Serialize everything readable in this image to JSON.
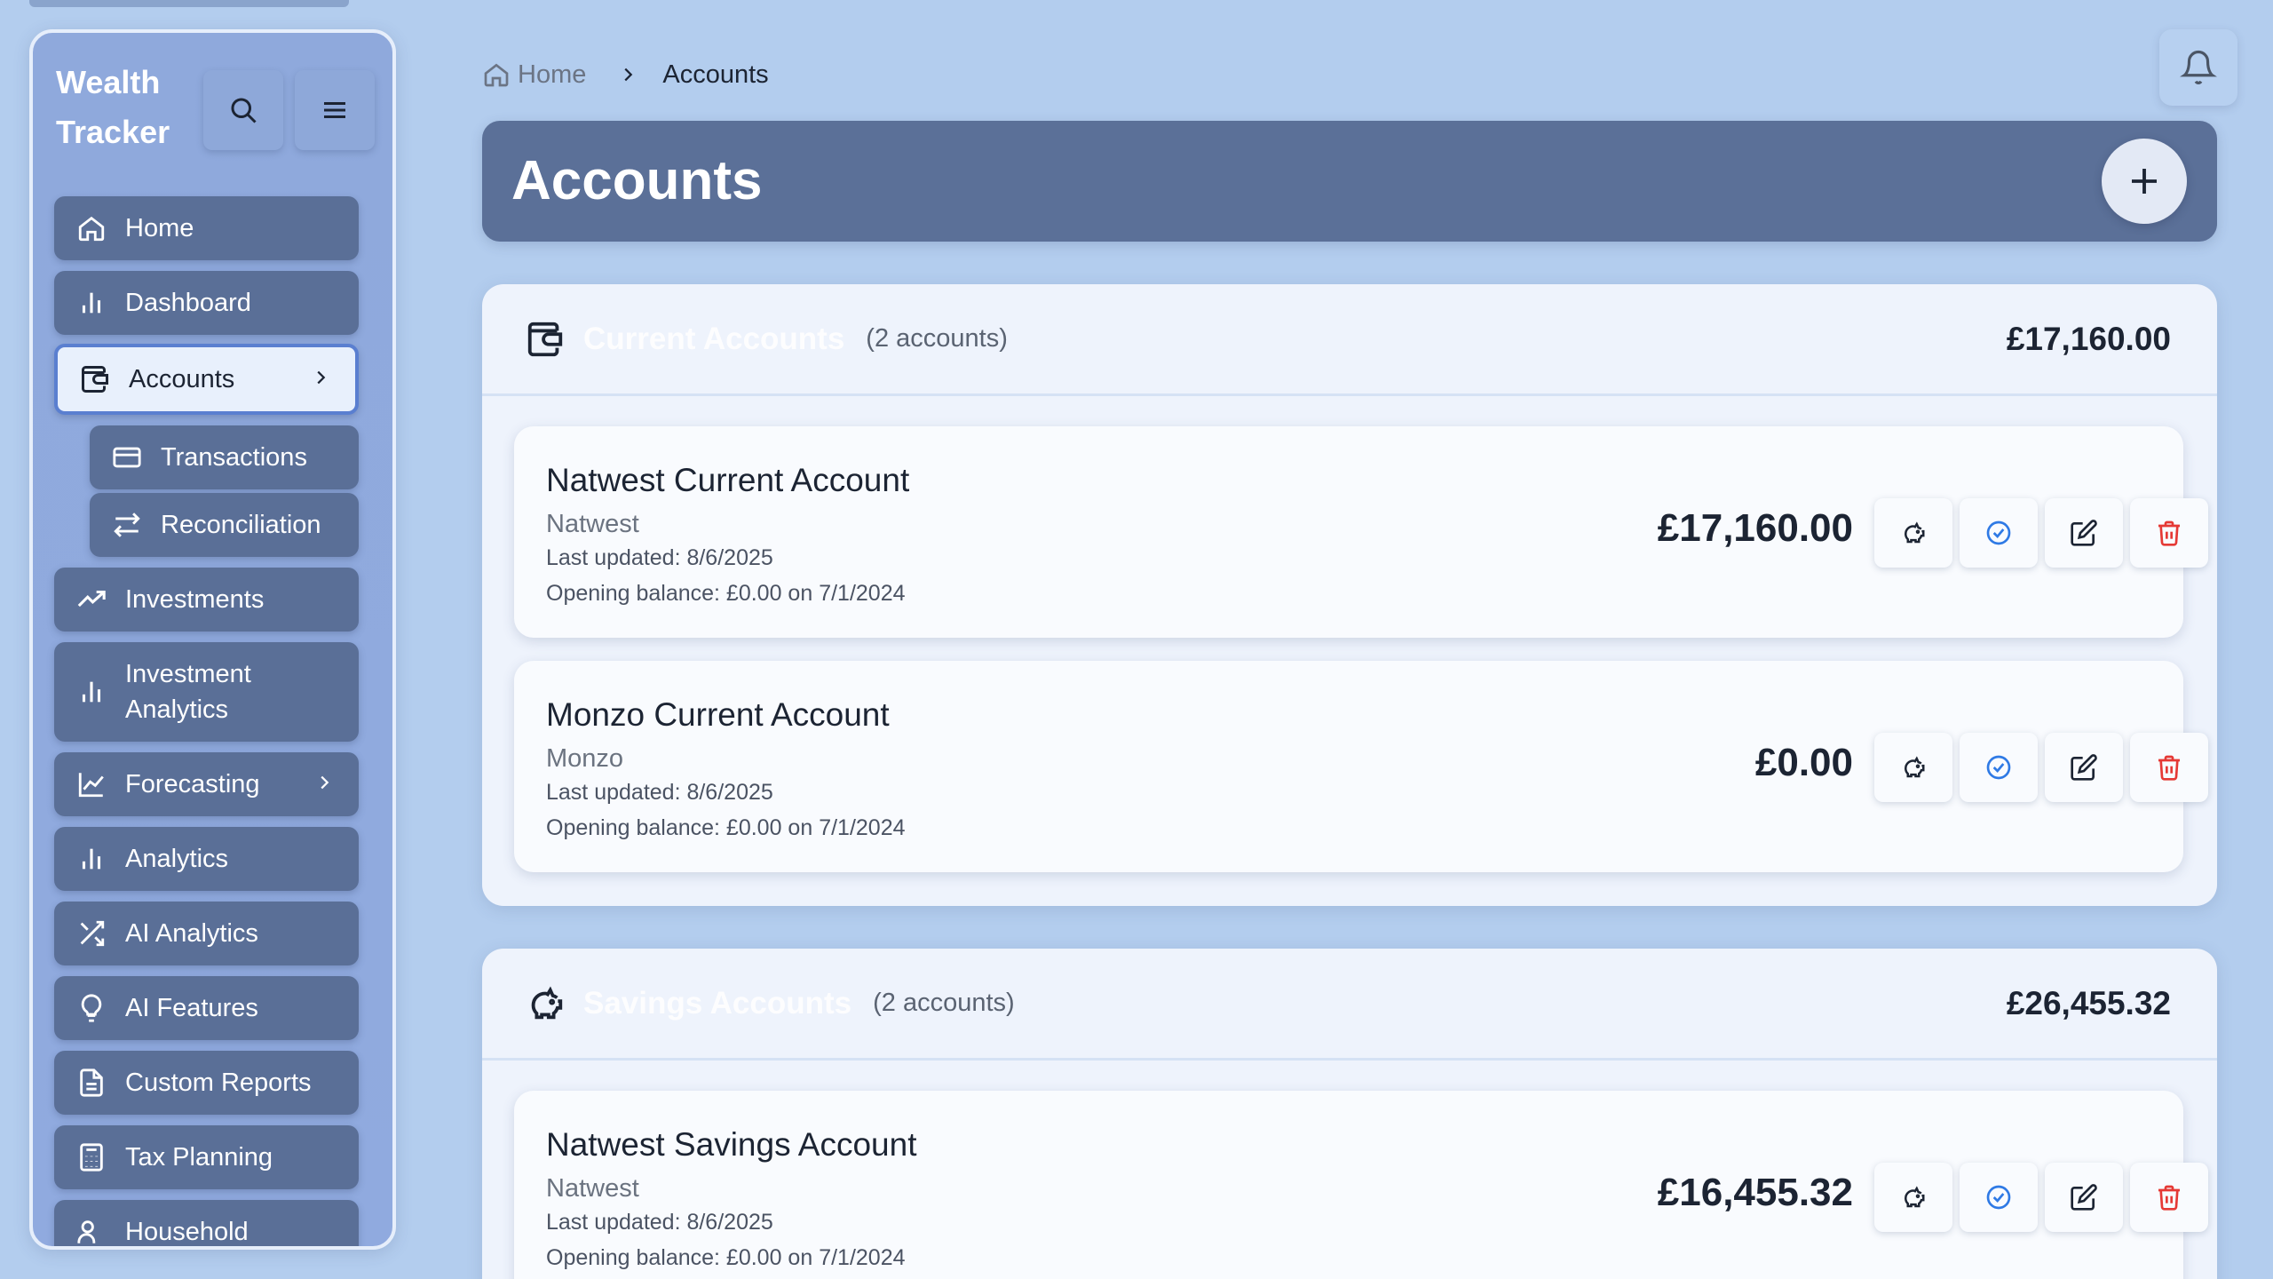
{
  "app": {
    "brand": "Wealth Tracker"
  },
  "sidebar": {
    "items": [
      {
        "label": "Home",
        "icon": "home-icon"
      },
      {
        "label": "Dashboard",
        "icon": "bar-chart-icon"
      },
      {
        "label": "Accounts",
        "icon": "wallet-icon",
        "active": true
      },
      {
        "label": "Transactions",
        "icon": "credit-card-icon"
      },
      {
        "label": "Reconciliation",
        "icon": "arrows-swap-icon"
      },
      {
        "label": "Investments",
        "icon": "trending-up-icon"
      },
      {
        "label": "Investment Analytics",
        "icon": "bar-chart-icon"
      },
      {
        "label": "Forecasting",
        "icon": "line-chart-icon"
      },
      {
        "label": "Analytics",
        "icon": "bar-chart-icon"
      },
      {
        "label": "AI Analytics",
        "icon": "shuffle-icon"
      },
      {
        "label": "AI Features",
        "icon": "lightbulb-icon"
      },
      {
        "label": "Custom Reports",
        "icon": "document-icon"
      },
      {
        "label": "Tax Planning",
        "icon": "calculator-icon"
      },
      {
        "label": "Household",
        "icon": "users-icon"
      }
    ]
  },
  "breadcrumb": {
    "home": "Home",
    "current": "Accounts"
  },
  "page": {
    "title": "Accounts"
  },
  "sections": [
    {
      "title": "Current Accounts",
      "count": "(2 accounts)",
      "total": "£17,160.00",
      "accounts": [
        {
          "name": "Natwest Current Account",
          "bank": "Natwest",
          "updated": "Last updated: 8/6/2025",
          "opening": "Opening balance: £0.00 on 7/1/2024",
          "balance": "£17,160.00"
        },
        {
          "name": "Monzo Current Account",
          "bank": "Monzo",
          "updated": "Last updated: 8/6/2025",
          "opening": "Opening balance: £0.00 on 7/1/2024",
          "balance": "£0.00"
        }
      ]
    },
    {
      "title": "Savings Accounts",
      "count": "(2 accounts)",
      "total": "£26,455.32",
      "accounts": [
        {
          "name": "Natwest Savings Account",
          "bank": "Natwest",
          "updated": "Last updated: 8/6/2025",
          "opening": "Opening balance: £0.00 on 7/1/2024",
          "balance": "£16,455.32"
        }
      ]
    }
  ],
  "colors": {
    "background": "#b3cdee",
    "sidebar": "#8fa9dc",
    "nav_item": "#5a6f97",
    "active_border": "#5a7fd0",
    "title_bar": "#5b7098",
    "reconcile_blue": "#2f7ae5",
    "delete_red": "#e53935"
  }
}
